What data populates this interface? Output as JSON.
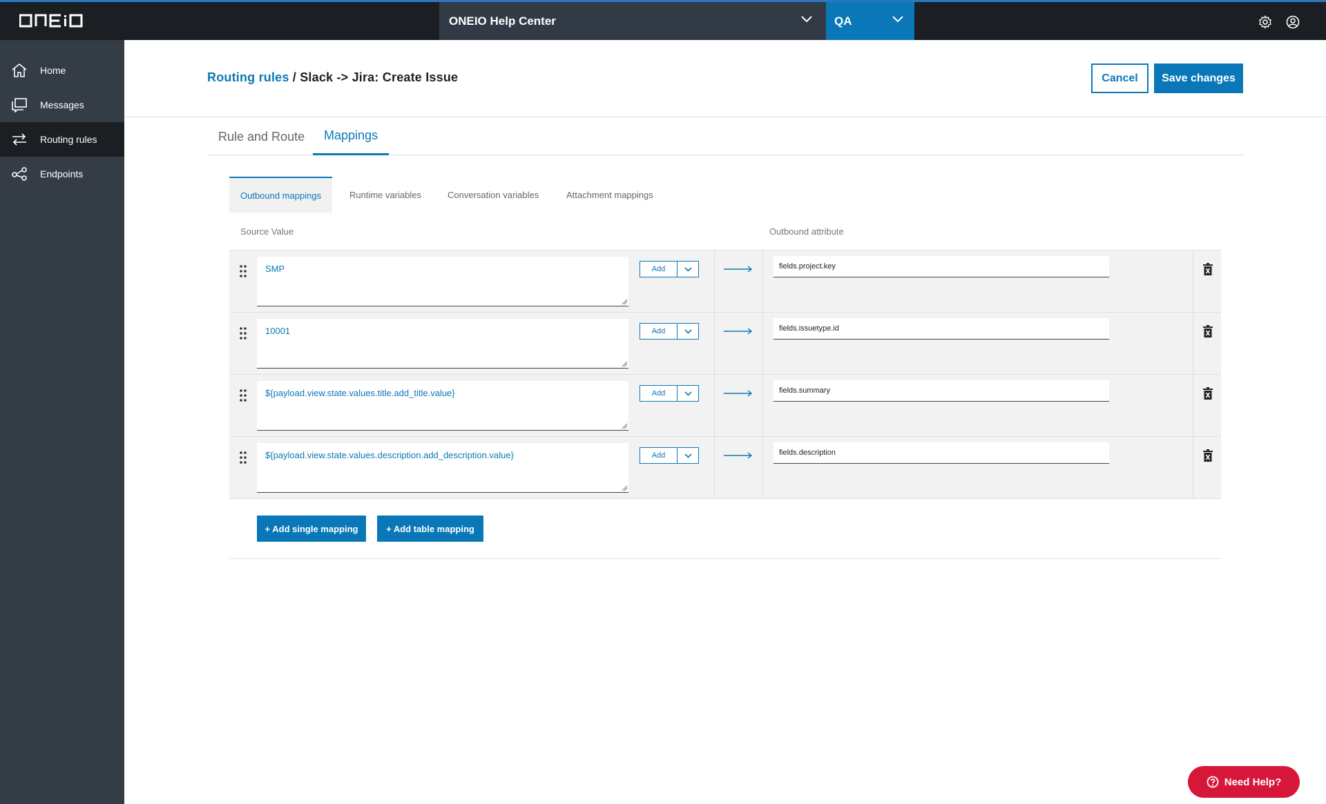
{
  "app": {
    "logo_text": "ONEiO",
    "organization": "ONEIO Help Center",
    "environment": "QA"
  },
  "sidebar": {
    "items": [
      {
        "label": "Home",
        "icon": "home-icon"
      },
      {
        "label": "Messages",
        "icon": "messages-icon"
      },
      {
        "label": "Routing rules",
        "icon": "routing-icon",
        "active": true
      },
      {
        "label": "Endpoints",
        "icon": "endpoints-icon"
      }
    ]
  },
  "header": {
    "breadcrumb_link": "Routing rules",
    "breadcrumb_sep": " / ",
    "breadcrumb_current": "Slack -> Jira: Create Issue",
    "cancel_label": "Cancel",
    "save_label": "Save changes"
  },
  "main_tabs": [
    {
      "label": "Rule and Route",
      "active": false
    },
    {
      "label": "Mappings",
      "active": true
    }
  ],
  "sub_tabs": [
    {
      "label": "Outbound mappings",
      "active": true
    },
    {
      "label": "Runtime variables",
      "active": false
    },
    {
      "label": "Conversation variables",
      "active": false
    },
    {
      "label": "Attachment mappings",
      "active": false
    }
  ],
  "columns": {
    "source": "Source Value",
    "outbound": "Outbound attribute"
  },
  "mappings": [
    {
      "source": "SMP",
      "add_label": "Add",
      "outbound": "fields.project.key"
    },
    {
      "source": "10001",
      "add_label": "Add",
      "outbound": "fields.issuetype.id"
    },
    {
      "source": "${payload.view.state.values.title.add_title.value}",
      "add_label": "Add",
      "outbound": "fields.summary"
    },
    {
      "source": "${payload.view.state.values.description.add_description.value}",
      "add_label": "Add",
      "outbound": "fields.description"
    }
  ],
  "actions": {
    "add_single": "+ Add single mapping",
    "add_table": "+ Add table mapping"
  },
  "help": {
    "label": "Need Help?"
  },
  "colors": {
    "accent": "#0a78b8",
    "topbar": "#1b1f24",
    "sidebar": "#343c46",
    "help": "#d6173a"
  }
}
